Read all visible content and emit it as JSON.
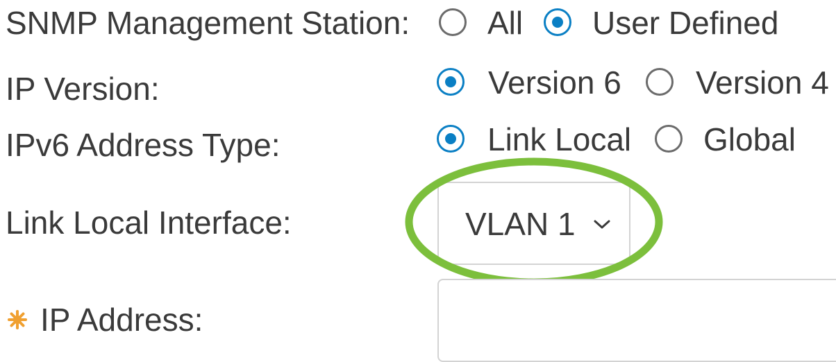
{
  "form": {
    "snmp_station": {
      "label": "SNMP Management Station:",
      "options": [
        {
          "label": "All",
          "selected": false
        },
        {
          "label": "User Defined",
          "selected": true
        }
      ]
    },
    "ip_version": {
      "label": "IP Version:",
      "options": [
        {
          "label": "Version 6",
          "selected": true
        },
        {
          "label": "Version 4",
          "selected": false
        }
      ]
    },
    "ipv6_address_type": {
      "label": "IPv6 Address Type:",
      "options": [
        {
          "label": "Link Local",
          "selected": true
        },
        {
          "label": "Global",
          "selected": false
        }
      ]
    },
    "link_local_interface": {
      "label": "Link Local Interface:",
      "value": "VLAN 1"
    },
    "ip_address": {
      "label": "IP Address:",
      "value": "",
      "required": true
    }
  },
  "colors": {
    "radio_selected": "#0a7fc4",
    "required_icon": "#f0a030",
    "highlight_ring": "#7cbf3c"
  },
  "icons": {
    "required": "required-asterisk-icon",
    "dropdown": "chevron-down-icon"
  }
}
